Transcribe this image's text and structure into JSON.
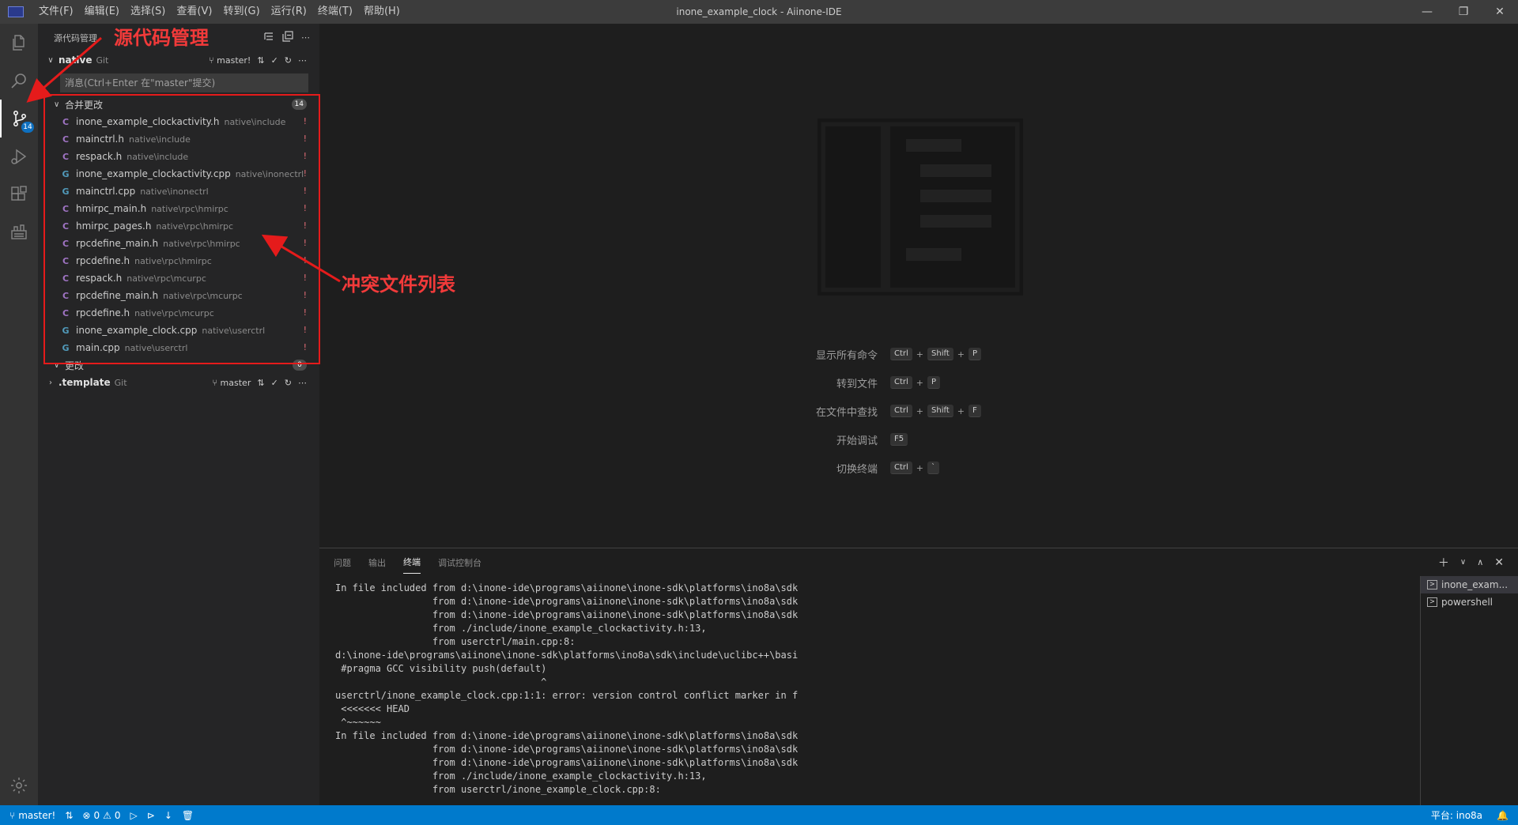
{
  "titlebar": {
    "menus": [
      "文件(F)",
      "编辑(E)",
      "选择(S)",
      "查看(V)",
      "转到(G)",
      "运行(R)",
      "终端(T)",
      "帮助(H)"
    ],
    "window_title": "inone_example_clock - Aiinone-IDE",
    "controls": {
      "minimize": "—",
      "restore": "❐",
      "close": "✕"
    }
  },
  "activitybar": {
    "items": [
      "explorer-icon",
      "search-icon",
      "source-control-icon",
      "run-debug-icon",
      "extensions-icon",
      "device-tool-icon"
    ],
    "scm_badge": "14",
    "bottom": "settings-gear-icon"
  },
  "sidebar": {
    "title": "源代码管理",
    "repo": {
      "name": "native",
      "scm": "Git",
      "branch": "master!"
    },
    "commit_placeholder": "消息(Ctrl+Enter 在\"master\"提交)",
    "merge_group": {
      "label": "合并更改",
      "count": "14"
    },
    "files": [
      {
        "icon": "C",
        "kind": "c",
        "name": "inone_example_clockactivity.h",
        "path": "native\\include",
        "status": "!"
      },
      {
        "icon": "C",
        "kind": "c",
        "name": "mainctrl.h",
        "path": "native\\include",
        "status": "!"
      },
      {
        "icon": "C",
        "kind": "c",
        "name": "respack.h",
        "path": "native\\include",
        "status": "!"
      },
      {
        "icon": "G",
        "kind": "cpp",
        "name": "inone_example_clockactivity.cpp",
        "path": "native\\inonectrl",
        "status": "!"
      },
      {
        "icon": "G",
        "kind": "cpp",
        "name": "mainctrl.cpp",
        "path": "native\\inonectrl",
        "status": "!"
      },
      {
        "icon": "C",
        "kind": "c",
        "name": "hmirpc_main.h",
        "path": "native\\rpc\\hmirpc",
        "status": "!"
      },
      {
        "icon": "C",
        "kind": "c",
        "name": "hmirpc_pages.h",
        "path": "native\\rpc\\hmirpc",
        "status": "!"
      },
      {
        "icon": "C",
        "kind": "c",
        "name": "rpcdefine_main.h",
        "path": "native\\rpc\\hmirpc",
        "status": "!"
      },
      {
        "icon": "C",
        "kind": "c",
        "name": "rpcdefine.h",
        "path": "native\\rpc\\hmirpc",
        "status": "!"
      },
      {
        "icon": "C",
        "kind": "c",
        "name": "respack.h",
        "path": "native\\rpc\\mcurpc",
        "status": "!"
      },
      {
        "icon": "C",
        "kind": "c",
        "name": "rpcdefine_main.h",
        "path": "native\\rpc\\mcurpc",
        "status": "!"
      },
      {
        "icon": "C",
        "kind": "c",
        "name": "rpcdefine.h",
        "path": "native\\rpc\\mcurpc",
        "status": "!"
      },
      {
        "icon": "G",
        "kind": "cpp",
        "name": "inone_example_clock.cpp",
        "path": "native\\userctrl",
        "status": "!"
      },
      {
        "icon": "G",
        "kind": "cpp",
        "name": "main.cpp",
        "path": "native\\userctrl",
        "status": "!"
      }
    ],
    "changes_group": {
      "label": "更改",
      "count": "0"
    },
    "template_repo": {
      "name": ".template",
      "scm": "Git",
      "branch": "master"
    }
  },
  "annotations": {
    "scm_label": "源代码管理",
    "conflict_label": "冲突文件列表",
    "color": "#f23a3a"
  },
  "welcome": {
    "shortcuts": [
      {
        "label": "显示所有命令",
        "keys": [
          "Ctrl",
          "Shift",
          "P"
        ]
      },
      {
        "label": "转到文件",
        "keys": [
          "Ctrl",
          "P"
        ]
      },
      {
        "label": "在文件中查找",
        "keys": [
          "Ctrl",
          "Shift",
          "F"
        ]
      },
      {
        "label": "开始调试",
        "keys": [
          "F5"
        ]
      },
      {
        "label": "切换终端",
        "keys": [
          "Ctrl",
          "`"
        ]
      }
    ]
  },
  "panel": {
    "tabs": [
      "问题",
      "输出",
      "终端",
      "调试控制台"
    ],
    "active_tab": "终端",
    "terminal_lines": [
      "In file included from d:\\inone-ide\\programs\\aiinone\\inone-sdk\\platforms\\ino8a\\sdk",
      "                 from d:\\inone-ide\\programs\\aiinone\\inone-sdk\\platforms\\ino8a\\sdk",
      "                 from d:\\inone-ide\\programs\\aiinone\\inone-sdk\\platforms\\ino8a\\sdk",
      "                 from ./include/inone_example_clockactivity.h:13,",
      "                 from userctrl/main.cpp:8:",
      "d:\\inone-ide\\programs\\aiinone\\inone-sdk\\platforms\\ino8a\\sdk\\include\\uclibc++\\basi",
      " #pragma GCC visibility push(default)",
      "                                    ^",
      "userctrl/inone_example_clock.cpp:1:1: error: version control conflict marker in f",
      " <<<<<<< HEAD",
      " ^~~~~~~",
      "In file included from d:\\inone-ide\\programs\\aiinone\\inone-sdk\\platforms\\ino8a\\sdk",
      "                 from d:\\inone-ide\\programs\\aiinone\\inone-sdk\\platforms\\ino8a\\sdk",
      "                 from d:\\inone-ide\\programs\\aiinone\\inone-sdk\\platforms\\ino8a\\sdk",
      "                 from ./include/inone_example_clockactivity.h:13,",
      "                 from userctrl/inone_example_clock.cpp:8:"
    ],
    "terminals": [
      "inone_exam...",
      "powershell"
    ]
  },
  "statusbar": {
    "branch": "master!",
    "errors": "0",
    "warnings": "0",
    "platform": "平台: ino8a"
  }
}
